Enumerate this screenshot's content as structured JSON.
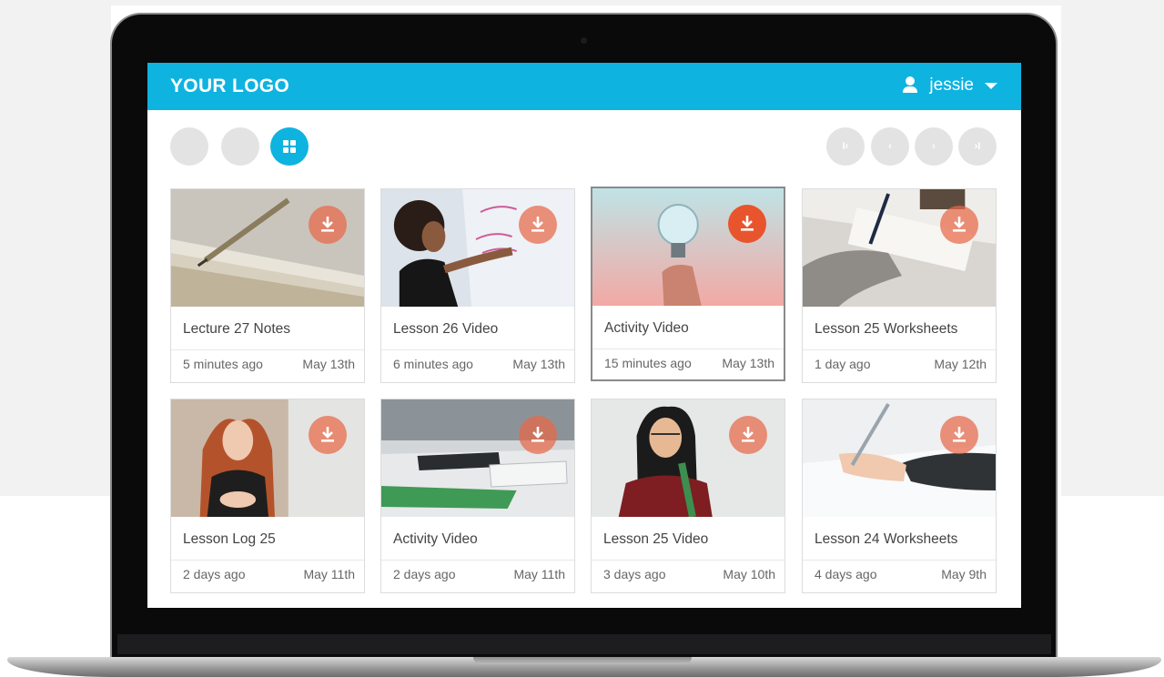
{
  "header": {
    "logo": "YOUR LOGO",
    "username": "jessie"
  },
  "colors": {
    "accent": "#0eb3e0",
    "download": "#e8542c",
    "card_border": "#dcdcdc"
  },
  "icons": {
    "user": "user-icon",
    "dropdown": "caret-down-icon",
    "grid_view": "grid-view-icon",
    "first": "first-page-icon",
    "prev": "chevron-left-icon",
    "next": "chevron-right-icon",
    "last": "last-page-icon",
    "download": "download-icon"
  },
  "pagination": {
    "first": "I‹",
    "prev": "‹",
    "next": "›",
    "last": "›I"
  },
  "cards": [
    {
      "title": "Lecture 27 Notes",
      "time": "5 minutes ago",
      "date": "May 13th",
      "thumb": "pencil-notebook"
    },
    {
      "title": "Lesson 26 Video",
      "time": "6 minutes ago",
      "date": "May 13th",
      "thumb": "whiteboard-student"
    },
    {
      "title": "Activity Video",
      "time": "15 minutes ago",
      "date": "May 13th",
      "thumb": "lightbulb",
      "selected": true
    },
    {
      "title": "Lesson 25 Worksheets",
      "time": "1 day ago",
      "date": "May 12th",
      "thumb": "writing-desk"
    },
    {
      "title": "Lesson Log 25",
      "time": "2 days ago",
      "date": "May 11th",
      "thumb": "presenter"
    },
    {
      "title": "Activity Video",
      "time": "2 days ago",
      "date": "May 11th",
      "thumb": "desk-keyboard"
    },
    {
      "title": "Lesson 25 Video",
      "time": "3 days ago",
      "date": "May 10th",
      "thumb": "glasses-student"
    },
    {
      "title": "Lesson 24 Worksheets",
      "time": "4 days ago",
      "date": "May 9th",
      "thumb": "hand-pen"
    }
  ]
}
